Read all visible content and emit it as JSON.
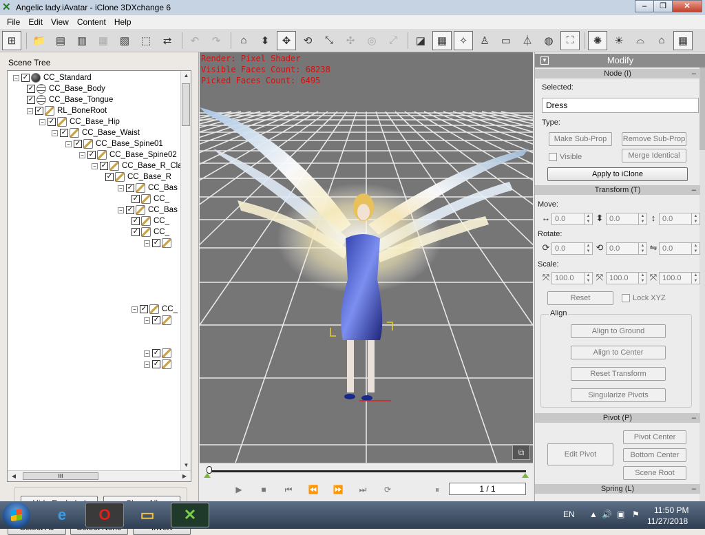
{
  "window": {
    "title": "Angelic lady.iAvatar - iClone 3DXchange 6",
    "btn_min": "–",
    "btn_max": "❐",
    "btn_close": "✕"
  },
  "menu": [
    "File",
    "Edit",
    "View",
    "Content",
    "Help"
  ],
  "toolbar_icons": [
    "scene-tree-icon",
    "open-folder-icon",
    "export-ic-icon",
    "export-fbx-icon",
    "export-bvh-icon",
    "export-obj-icon",
    "pack-icon",
    "convert-icon",
    "undo-icon",
    "redo-icon",
    "home-icon",
    "move-down-icon",
    "move-icon",
    "rotate-icon",
    "pick-icon",
    "snap-icon",
    "orbit-icon",
    "scale-icon",
    "wireframe-toggle-icon",
    "grid-icon",
    "axis-icon",
    "light-person-icon",
    "box-icon",
    "camera-icon",
    "sphere-icon",
    "fit-icon",
    "ambient-light-icon",
    "sun-icon",
    "spot-light-icon",
    "museum-icon"
  ],
  "scene_tree": {
    "label": "Scene Tree",
    "rows": [
      {
        "text": "CC_Standard",
        "icon": "sphere"
      },
      {
        "text": "CC_Base_Body",
        "icon": "mesh"
      },
      {
        "text": "CC_Base_Tongue",
        "icon": "mesh"
      },
      {
        "text": "RL_BoneRoot",
        "icon": "bone"
      },
      {
        "text": "CC_Base_Hip",
        "icon": "bone"
      },
      {
        "text": "CC_Base_Waist",
        "icon": "bone"
      },
      {
        "text": "CC_Base_Spine01",
        "icon": "bone"
      },
      {
        "text": "CC_Base_Spine02",
        "icon": "bone"
      },
      {
        "text": "CC_Base_R_Cla",
        "icon": "bone"
      },
      {
        "text": "CC_Base_R",
        "icon": "bone"
      },
      {
        "text": "CC_Bas",
        "icon": "bone"
      },
      {
        "text": "CC_",
        "icon": "bone"
      },
      {
        "text": "CC_Bas",
        "icon": "bone"
      },
      {
        "text": "CC_",
        "icon": "bone"
      },
      {
        "text": "CC_",
        "icon": "bone"
      },
      {
        "text": "",
        "icon": "bone"
      },
      {
        "text": "CC_",
        "icon": "bone"
      },
      {
        "text": "",
        "icon": "bone"
      },
      {
        "text": "",
        "icon": "bone"
      },
      {
        "text": "",
        "icon": "bone"
      }
    ],
    "hscroll_thumb": "III",
    "buttons": {
      "hide_excluded": "Hide Excluded",
      "show_all": "Show All",
      "select_all": "Select All",
      "select_none": "Select None",
      "invert": "Invert"
    }
  },
  "viewport": {
    "stats": [
      "Render: Pixel Shader",
      "Visible Faces Count: 68238",
      "Picked Faces Count: 6495"
    ]
  },
  "timeline": {
    "frame": "1 / 1",
    "controls": [
      "▶",
      "■",
      "⏮",
      "⏪",
      "⏩",
      "⏭",
      "⟳",
      "⏸"
    ]
  },
  "modify": {
    "title": "Modify",
    "node_section": "Node (I)",
    "selected_label": "Selected:",
    "selected_value": "Dress",
    "type_label": "Type:",
    "make_sub_prop": "Make Sub-Prop",
    "remove_sub_prop": "Remove Sub-Prop",
    "visible": "Visible",
    "merge_identical": "Merge Identical",
    "apply": "Apply to iClone",
    "transform_section": "Transform (T)",
    "move_label": "Move:",
    "move": [
      "0.0",
      "0.0",
      "0.0"
    ],
    "rotate_label": "Rotate:",
    "rotate": [
      "0.0",
      "0.0",
      "0.0"
    ],
    "scale_label": "Scale:",
    "scale": [
      "100.0",
      "100.0",
      "100.0"
    ],
    "reset": "Reset",
    "lock_xyz": "Lock XYZ",
    "align_label": "Align",
    "align_ground": "Align to Ground",
    "align_center": "Align to Center",
    "reset_transform": "Reset Transform",
    "singularize": "Singularize Pivots",
    "pivot_section": "Pivot (P)",
    "edit_pivot": "Edit Pivot",
    "pivot_center": "Pivot Center",
    "bottom_center": "Bottom Center",
    "scene_root": "Scene Root",
    "spring_section": "Spring (L)"
  },
  "taskbar": {
    "lang": "EN",
    "time": "11:50 PM",
    "date": "11/27/2018"
  },
  "colors": {
    "viewport_bg": "#767676",
    "grid": "#ffffff",
    "stat_text": "#d21010",
    "accent_green": "#7ab83a"
  }
}
